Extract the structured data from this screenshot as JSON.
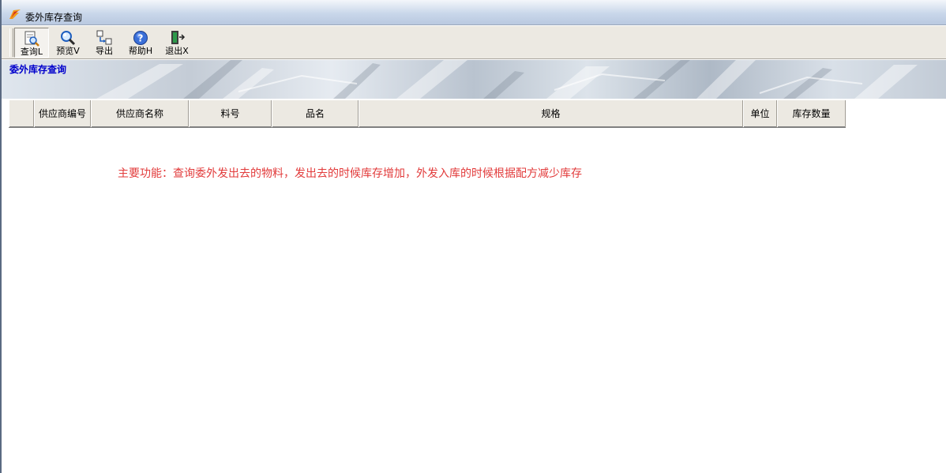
{
  "window": {
    "title": "委外库存查询"
  },
  "toolbar": {
    "buttons": [
      {
        "id": "query",
        "label": "查询L",
        "icon": "document-magnifier-icon",
        "pressed": true
      },
      {
        "id": "preview",
        "label": "预览V",
        "icon": "magnifier-icon",
        "pressed": false
      },
      {
        "id": "export",
        "label": "导出",
        "icon": "export-icon",
        "pressed": false
      },
      {
        "id": "help",
        "label": "帮助H",
        "icon": "help-icon",
        "pressed": false
      },
      {
        "id": "exit",
        "label": "退出X",
        "icon": "exit-door-icon",
        "pressed": false
      }
    ]
  },
  "banner": {
    "title": "委外库存查询"
  },
  "grid": {
    "columns": [
      "",
      "供应商编号",
      "供应商名称",
      "料号",
      "品名",
      "规格",
      "单位",
      "库存数量"
    ],
    "rows": []
  },
  "hint": {
    "text": "主要功能：查询委外发出去的物料，发出去的时候库存增加，外发入库的时候根据配方减少库存"
  },
  "colors": {
    "banner_title": "#0000cc",
    "hint_text": "#e23b3b",
    "toolbar_bg": "#ece9e2"
  }
}
